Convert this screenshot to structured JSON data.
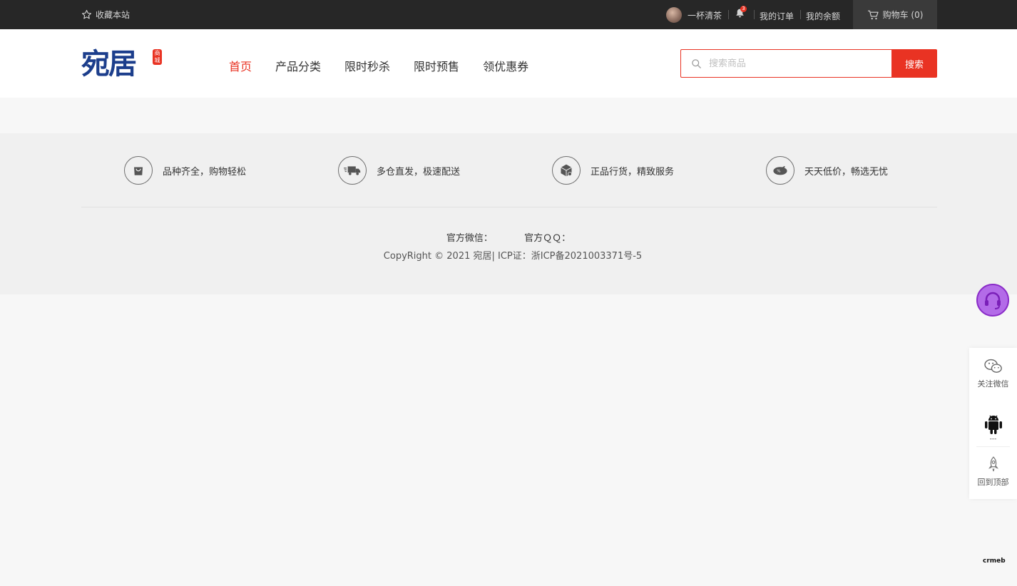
{
  "topbar": {
    "favorite_label": "收藏本站",
    "username": "一杯清茶",
    "notification_count": "3",
    "my_orders": "我的订单",
    "my_balance": "我的余额",
    "cart_label": "购物车 (0)"
  },
  "header": {
    "logo_text": "宛居",
    "logo_seal": "商城",
    "nav": [
      "首页",
      "产品分类",
      "限时秒杀",
      "限时预售",
      "领优惠券"
    ],
    "active_nav_index": 0,
    "search_placeholder": "搜索商品",
    "search_button": "搜索"
  },
  "footer": {
    "features": [
      "品种齐全，购物轻松",
      "多仓直发，极速配送",
      "正品行货，精致服务",
      "天天低价，畅选无忧"
    ],
    "wechat_label": "官方微信：",
    "qq_label": "官方ＱＱ：",
    "copyright": "CopyRight © 2021 宛居| ICP证：浙ICP备2021003371号-5"
  },
  "sidebar": {
    "wechat": "关注微信",
    "android": "---",
    "back_top": "回到顶部"
  },
  "brand_badge": "crmeb",
  "colors": {
    "accent": "#e93323",
    "topbar_bg": "#272727",
    "logo_blue": "#1c3e8c",
    "service_purple": "#b36be8"
  }
}
